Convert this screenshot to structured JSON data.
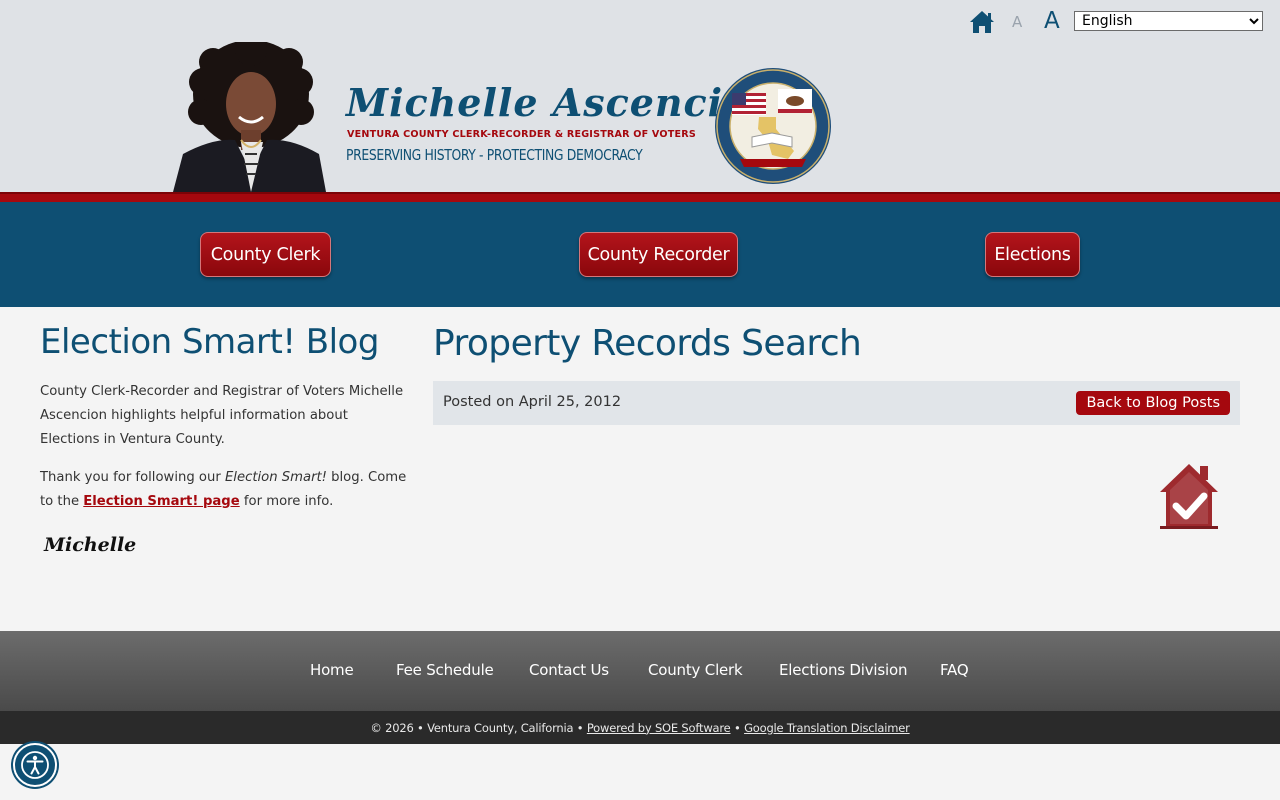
{
  "header": {
    "language_selected": "English",
    "font_small_label": "A",
    "font_large_label": "A",
    "name": "Michelle Ascencion",
    "subtitle": "VENTURA COUNTY CLERK-RECORDER & REGISTRAR OF VOTERS",
    "tagline": "PRESERVING HISTORY - PROTECTING DEMOCRACY"
  },
  "nav": [
    {
      "label": "County Clerk"
    },
    {
      "label": "County Recorder"
    },
    {
      "label": "Elections"
    }
  ],
  "sidebar": {
    "title": "Election Smart! Blog",
    "intro": "County Clerk-Recorder and Registrar of Voters Michelle Ascencion highlights helpful information about Elections in Ventura County.",
    "thanks_before": "Thank you for following our ",
    "thanks_em": "Election Smart!",
    "thanks_after": " blog. Come to the ",
    "link_text": "Election Smart! page",
    "thanks_end": " for more info.",
    "signature": "Michelle"
  },
  "post": {
    "title": "Property Records Search",
    "posted": "Posted on April 25, 2012",
    "back_label": "Back to Blog Posts"
  },
  "footer": {
    "links": [
      "Home",
      "Fee Schedule",
      "Contact Us",
      "County Clerk",
      "Elections Division",
      "FAQ"
    ],
    "copyright": "© 2026 • Ventura County, California •",
    "powered": "Powered by SOE Software",
    "sep": "•",
    "disclaimer": "Google Translation Disclaimer"
  },
  "colors": {
    "brand_blue": "#0e4f73",
    "brand_red": "#a5080e",
    "header_bg": "#dfe2e6",
    "page_bg": "#f4f4f4"
  },
  "icons": [
    "home-icon",
    "house-check-icon",
    "county-seal-icon",
    "accessibility-icon"
  ]
}
